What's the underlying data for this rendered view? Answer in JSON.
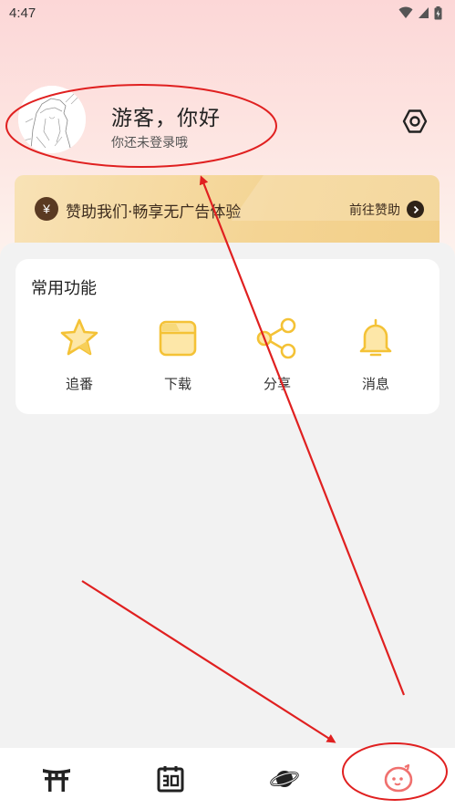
{
  "status_bar": {
    "time": "4:47",
    "icons": [
      "wifi-icon",
      "signal-icon",
      "battery-icon"
    ]
  },
  "profile": {
    "name": "游客，你好",
    "subtitle": "你还未登录哦",
    "avatar_icon": "sketch-avatar",
    "settings_icon": "hexagon-settings-icon"
  },
  "sponsor_banner": {
    "badge": "¥",
    "text": "赞助我们·畅享无广告体验",
    "link": "前往赞助",
    "arrow_icon": "chevron-right-icon"
  },
  "features": {
    "title": "常用功能",
    "items": [
      {
        "label": "追番",
        "icon": "star-icon"
      },
      {
        "label": "下载",
        "icon": "folder-icon"
      },
      {
        "label": "分享",
        "icon": "share-icon"
      },
      {
        "label": "消息",
        "icon": "bell-icon"
      }
    ]
  },
  "bottom_nav": {
    "items": [
      {
        "icon": "torii-gate-icon"
      },
      {
        "icon": "calendar-icon"
      },
      {
        "icon": "planet-icon"
      },
      {
        "icon": "mascot-face-icon",
        "active": true
      }
    ]
  },
  "annotation_color": "#e02020",
  "colors": {
    "accent": "#f7c84a",
    "active_tab": "#f0716f",
    "sponsor_gold": "#f4d493"
  }
}
